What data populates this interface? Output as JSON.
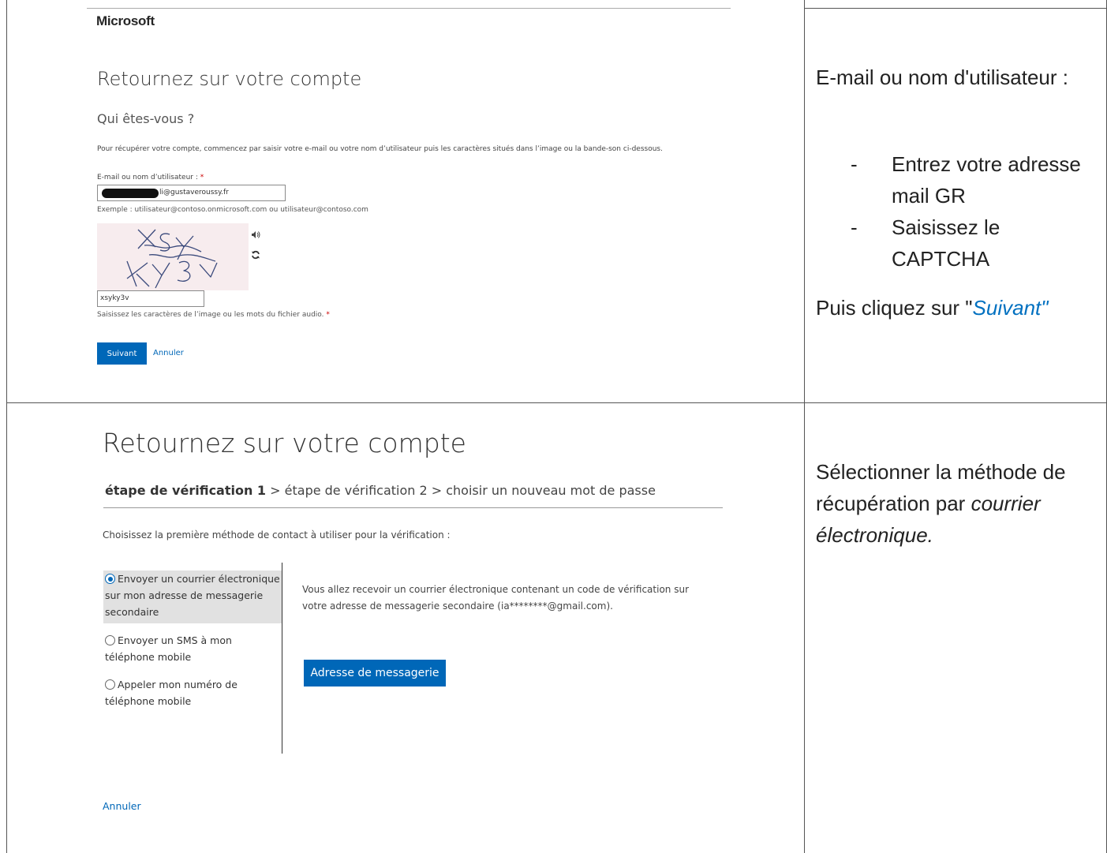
{
  "top_panel": {
    "brand": "Microsoft",
    "title": "Retournez sur votre compte",
    "subtitle": "Qui êtes-vous ?",
    "description": "Pour récupérer votre compte, commencez par saisir votre e-mail ou votre nom d’utilisateur puis les caractères situés dans l’image ou la bande-son ci-dessous.",
    "email_label": "E-mail ou nom d’utilisateur : ",
    "required_mark": "*",
    "email_value": "li@gustaveroussy.fr",
    "example": "Exemple : utilisateur@contoso.onmicrosoft.com ou utilisateur@contoso.com",
    "captcha_input_value": "xsyky3v",
    "captcha_help": "Saisissez les caractères de l’image ou les mots du fichier audio. ",
    "next_button": "Suivant",
    "cancel_link": "Annuler",
    "icons": [
      "speaker-icon",
      "refresh-icon"
    ]
  },
  "right_top": {
    "title": "E-mail ou nom d'utilisateur :",
    "bullets": [
      {
        "dash": "-",
        "text": "Entrez votre adresse mail GR"
      },
      {
        "dash": "-",
        "text": "Saisissez le CAPTCHA"
      }
    ],
    "then_prefix": "Puis cliquez sur \"",
    "then_link": "Suivant\"",
    "link_color": "#0070c0"
  },
  "bottom_panel": {
    "title": "Retournez sur votre compte",
    "step1": "étape de vérification 1",
    "steps_rest": " > étape de vérification 2 > choisir un nouveau mot de passe",
    "instruction": "Choisissez la première méthode de contact à utiliser pour la vérification :",
    "options": [
      {
        "label": "Envoyer un courrier électronique sur mon adresse de messagerie secondaire",
        "selected": true
      },
      {
        "label": "Envoyer un SMS à mon téléphone mobile",
        "selected": false
      },
      {
        "label": "Appeler mon numéro de téléphone mobile",
        "selected": false
      }
    ],
    "info": "Vous allez recevoir un courrier électronique contenant un code de vérification sur votre adresse de messagerie secondaire (ia********@gmail.com).",
    "email_button": "Adresse de messagerie",
    "cancel_link": "Annuler",
    "accent": "#0067b8"
  },
  "right_bottom": {
    "text_prefix": "Sélectionner la méthode de récupération par ",
    "text_em": "courrier électronique."
  }
}
